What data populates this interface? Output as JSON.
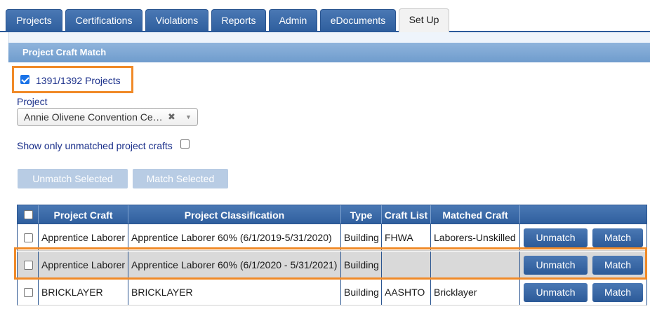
{
  "tabs": [
    {
      "label": "Projects"
    },
    {
      "label": "Certifications"
    },
    {
      "label": "Violations"
    },
    {
      "label": "Reports"
    },
    {
      "label": "Admin"
    },
    {
      "label": "eDocuments"
    },
    {
      "label": "Set Up"
    }
  ],
  "active_tab": "Set Up",
  "panel": {
    "title": "Project Craft Match"
  },
  "projects_toggle": {
    "label": "1391/1392 Projects",
    "checked": true
  },
  "project_field": {
    "label": "Project",
    "selected_value": "Annie Olivene Convention Ce…",
    "clear_glyph": "✖",
    "caret_glyph": "▼"
  },
  "unmatched_filter": {
    "label": "Show only unmatched project crafts",
    "checked": false
  },
  "actions": {
    "unmatch_selected": "Unmatch Selected",
    "match_selected": "Match Selected"
  },
  "table": {
    "columns": [
      "Project Craft",
      "Project Classification",
      "Type",
      "Craft List",
      "Matched Craft"
    ],
    "rows": [
      {
        "project_craft": "Apprentice Laborer",
        "classification": "Apprentice Laborer 60% (6/1/2019-5/31/2020)",
        "type": "Building",
        "craft_list": "FHWA",
        "matched_craft": "Laborers-Unskilled",
        "unmatch": "Unmatch",
        "match": "Match"
      },
      {
        "project_craft": "Apprentice Laborer",
        "classification": "Apprentice Laborer 60% (6/1/2020 - 5/31/2021)",
        "type": "Building",
        "craft_list": "",
        "matched_craft": "",
        "unmatch": "Unmatch",
        "match": "Match"
      },
      {
        "project_craft": "BRICKLAYER",
        "classification": "BRICKLAYER",
        "type": "Building",
        "craft_list": "AASHTO",
        "matched_craft": "Bricklayer",
        "unmatch": "Unmatch",
        "match": "Match"
      }
    ]
  },
  "colors": {
    "accent": "#2f5f9e",
    "highlight": "#f08a28",
    "header_light": "#7fa8d5"
  }
}
